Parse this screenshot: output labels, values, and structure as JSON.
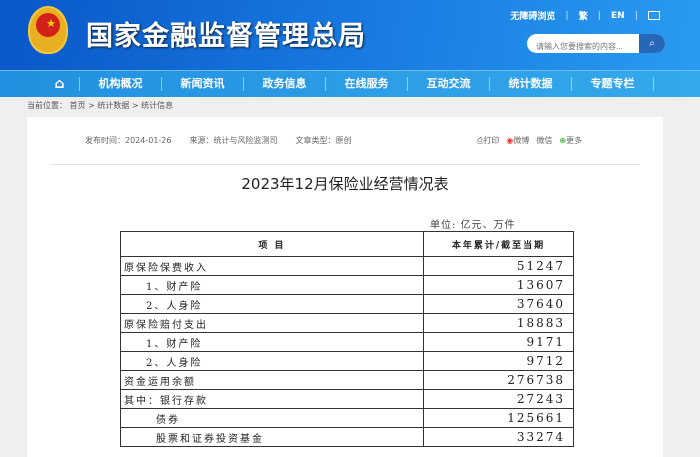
{
  "header": {
    "site_title": "国家金融监督管理总局",
    "links": [
      "无障碍浏览",
      "繁",
      "EN"
    ],
    "search_placeholder": "请输入您要搜索的内容..."
  },
  "nav": {
    "items": [
      "机构概况",
      "新闻资讯",
      "政务信息",
      "在线服务",
      "互动交流",
      "统计数据",
      "专题专栏"
    ]
  },
  "breadcrumb": {
    "label": "当前位置：",
    "path": "首页 > 统计数据 > 统计信息"
  },
  "article": {
    "publish": "发布时间：2024-01-26",
    "source": "来源：统计与风险监测司",
    "type": "文章类型：原创",
    "share": {
      "print": "打印",
      "weibo": "微博",
      "wechat": "微信",
      "more": "更多"
    },
    "title": "2023年12月保险业经营情况表",
    "unit": "单位: 亿元、万件",
    "table": {
      "headers": [
        "项 目",
        "本年累计/截至当期"
      ],
      "rows": [
        {
          "item": "原保险保费收入",
          "value": "51247",
          "indent": 0
        },
        {
          "item": "1、财产险",
          "value": "13607",
          "indent": 1
        },
        {
          "item": "2、人身险",
          "value": "37640",
          "indent": 1
        },
        {
          "item": "原保险赔付支出",
          "value": "18883",
          "indent": 0
        },
        {
          "item": "1、财产险",
          "value": "9171",
          "indent": 1
        },
        {
          "item": "2、人身险",
          "value": "9712",
          "indent": 1
        },
        {
          "item": "资金运用余额",
          "value": "276738",
          "indent": 0
        },
        {
          "item": "其中：银行存款",
          "value": "27243",
          "indent": 0
        },
        {
          "item": "债券",
          "value": "125661",
          "indent": 2
        },
        {
          "item": "股票和证券投资基金",
          "value": "33274",
          "indent": 2
        }
      ]
    }
  }
}
